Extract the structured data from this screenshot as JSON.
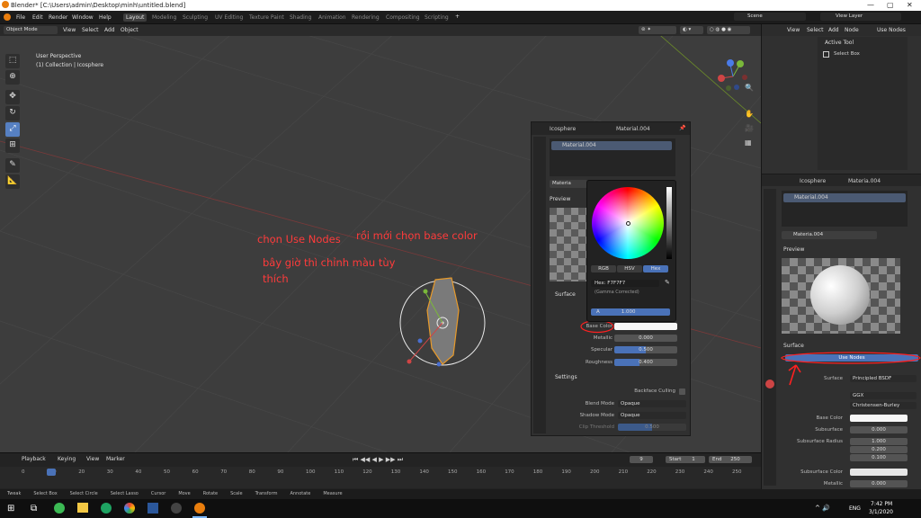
{
  "title": "Blender* [C:\\Users\\admin\\Desktop\\minh\\untitled.blend]",
  "menus": [
    "File",
    "Edit",
    "Render",
    "Window",
    "Help"
  ],
  "workspaces": [
    {
      "label": "Layout",
      "active": true
    },
    {
      "label": "Modeling"
    },
    {
      "label": "Sculpting"
    },
    {
      "label": "UV Editing"
    },
    {
      "label": "Texture Paint"
    },
    {
      "label": "Shading"
    },
    {
      "label": "Animation"
    },
    {
      "label": "Rendering"
    },
    {
      "label": "Compositing"
    },
    {
      "label": "Scripting"
    }
  ],
  "top_right": {
    "scene": "Scene",
    "view_layer": "View Layer"
  },
  "viewport_header": {
    "mode": "Object Mode",
    "view": "View",
    "select": "Select",
    "add": "Add",
    "object": "Object",
    "orientation_label": "Orientation:",
    "orientation": "Default",
    "drag_label": "Drag:",
    "drag": "Select Circle",
    "transform": "Global",
    "options": "Options"
  },
  "overlay": {
    "line1": "User Perspective",
    "line2": "(1) Collection | Icosphere"
  },
  "annotations": [
    "chọn Use Nodes",
    "rồi mới chọn base color",
    "bây giờ thì chỉnh màu tùy",
    "thích"
  ],
  "float_panel": {
    "object": "Icosphere",
    "material": "Material.004",
    "slot": "Material.004",
    "mat_field": "Materia",
    "preview": "Preview",
    "surface": "Surface",
    "base_color": "Base Color",
    "metallic": "Metallic",
    "metallic_val": "0.000",
    "specular": "Specular",
    "specular_val": "0.500",
    "roughness": "Roughness",
    "roughness_val": "0.400",
    "settings": "Settings",
    "backface": "Backface Culling",
    "blend_mode": "Blend Mode",
    "blend_val": "Opaque",
    "shadow_mode": "Shadow Mode",
    "shadow_val": "Opaque",
    "clip": "Clip Threshold",
    "clip_val": "0.500"
  },
  "color_picker": {
    "modes": [
      "RGB",
      "HSV",
      "Hex"
    ],
    "hex_label": "Hex: F7F7F7",
    "gamma": "(Gamma Corrected)",
    "alpha_label": "A",
    "alpha_val": "1.000"
  },
  "right_header": {
    "view": "View",
    "select": "Select",
    "add": "Add",
    "node": "Node",
    "use_nodes": "Use Nodes"
  },
  "active_tool": {
    "title": "Active Tool",
    "tool": "Select Box"
  },
  "props": {
    "object": "Icosphere",
    "material": "Materia.004",
    "slot": "Material.004",
    "mat_field": "Materia.004",
    "preview": "Preview",
    "surface": "Surface",
    "use_nodes": "Use Nodes",
    "surface_label": "Surface",
    "surface_val": "Principled BSDF",
    "ggx": "GGX",
    "christensen": "Christensen-Burley",
    "base_color": "Base Color",
    "subsurface": "Subsurface",
    "subsurface_val": "0.000",
    "subsurface_radius": "Subsurface Radius",
    "radius_vals": [
      "1.000",
      "0.200",
      "0.100"
    ],
    "subsurface_color": "Subsurface Color",
    "metallic": "Metallic",
    "metallic_val": "0.000"
  },
  "timeline": {
    "playback": "Playback",
    "keying": "Keying",
    "view": "View",
    "marker": "Marker",
    "current": "9",
    "start_label": "Start",
    "start": "1",
    "end_label": "End",
    "end": "250",
    "ticks": [
      "0",
      "10",
      "20",
      "30",
      "40",
      "50",
      "60",
      "70",
      "80",
      "90",
      "100",
      "110",
      "120",
      "130",
      "140",
      "150",
      "160",
      "170",
      "180",
      "190",
      "200",
      "210",
      "220",
      "230",
      "240",
      "250"
    ]
  },
  "statusbar": [
    "Tweak",
    "Select Box",
    "Select Circle",
    "Select Lasso",
    "Cursor",
    "Move",
    "Rotate",
    "Scale",
    "Transform",
    "Annotate",
    "Measure"
  ],
  "taskbar": {
    "time": "7:42 PM",
    "date": "3/1/2020",
    "lang": "ENG"
  }
}
